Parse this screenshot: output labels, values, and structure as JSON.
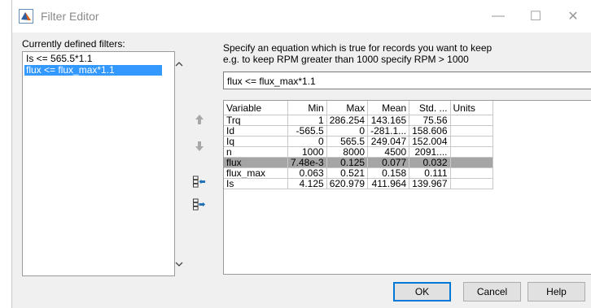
{
  "window": {
    "title": "Filter Editor",
    "minimize_glyph": "—",
    "maximize_glyph": "☐",
    "close_glyph": "✕"
  },
  "left": {
    "label": "Currently defined filters:",
    "filters": [
      "Is <= 565.5*1.1",
      "flux <= flux_max*1.1"
    ],
    "selected_index": 1
  },
  "instructions": {
    "line1": "Specify an equation which is true for records you want to keep",
    "line2": "e.g. to keep RPM greater than 1000 specify RPM > 1000"
  },
  "equation": {
    "value": "flux <= flux_max*1.1"
  },
  "table": {
    "headers": [
      "Variable",
      "Min",
      "Max",
      "Mean",
      "Std. ...",
      "Units"
    ],
    "rows": [
      [
        "Trq",
        "1",
        "286.254",
        "143.165",
        "75.56",
        ""
      ],
      [
        "Id",
        "-565.5",
        "0",
        "-281.1...",
        "158.606",
        ""
      ],
      [
        "Iq",
        "0",
        "565.5",
        "249.047",
        "152.004",
        ""
      ],
      [
        "n",
        "1000",
        "8000",
        "4500",
        "2091....",
        ""
      ],
      [
        "flux",
        "7.48e-3",
        "0.125",
        "0.077",
        "0.032",
        ""
      ],
      [
        "flux_max",
        "0.063",
        "0.521",
        "0.158",
        "0.111",
        ""
      ],
      [
        "Is",
        "4.125",
        "620.979",
        "411.964",
        "139.967",
        ""
      ]
    ],
    "highlighted_row": 4
  },
  "buttons": {
    "ok": "OK",
    "cancel": "Cancel",
    "help": "Help"
  },
  "colors": {
    "selection": "#3399ff",
    "row_highlight": "#a5a5a5",
    "default_button_border": "#0078d7"
  }
}
